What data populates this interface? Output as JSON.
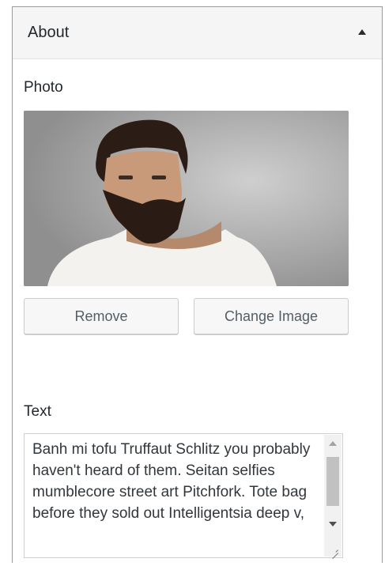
{
  "section": {
    "title": "About",
    "collapse_icon": "triangle-up-icon"
  },
  "photo": {
    "label": "Photo",
    "remove_label": "Remove",
    "change_label": "Change Image"
  },
  "text": {
    "label": "Text",
    "value": "Banh mi tofu Truffaut Schlitz you probably haven't heard of them. Seitan selfies mumblecore street art Pitchfork. Tote bag before they sold out Intelligentsia deep v,"
  }
}
